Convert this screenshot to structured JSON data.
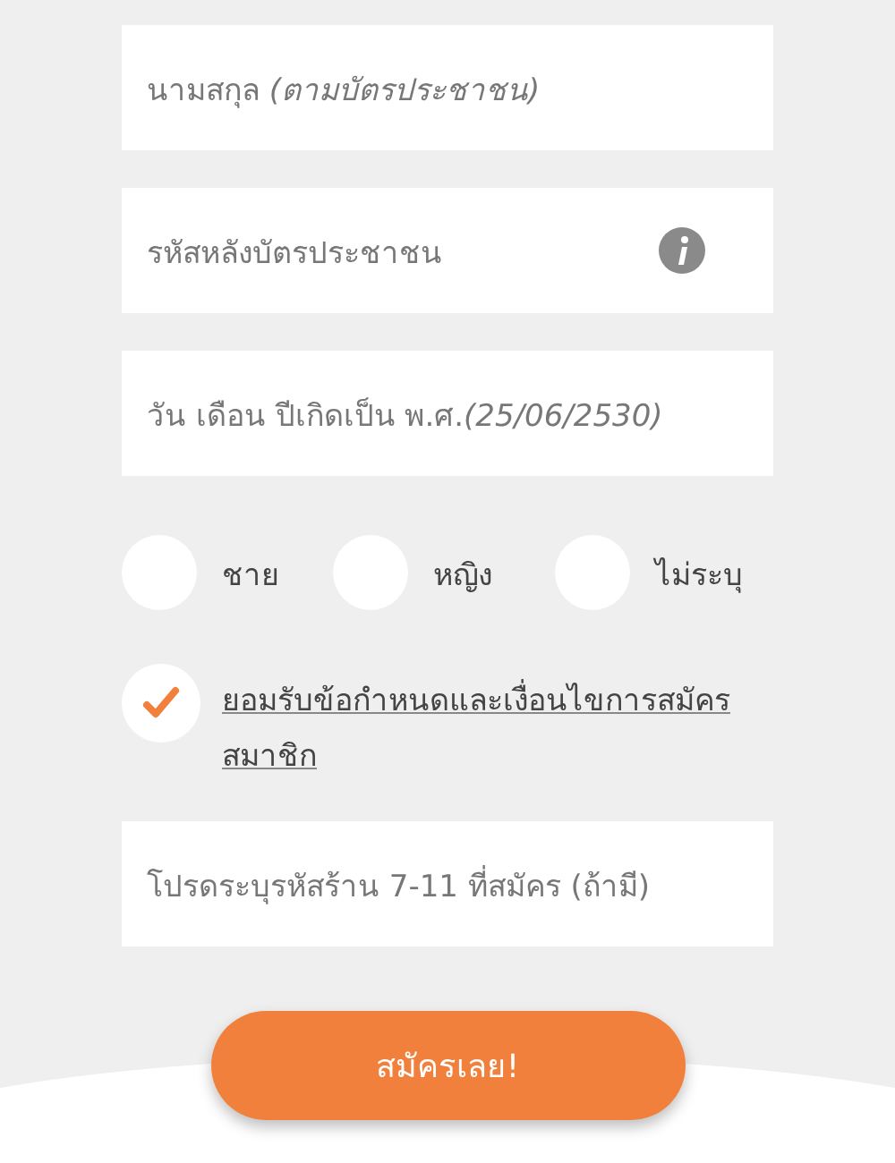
{
  "fields": [
    {
      "placeholder": "นามสกุล *(ตามบัตรประชาชน)*",
      "info": false
    },
    {
      "placeholder": "รหัสหลังบัตรประชาชน",
      "info": true
    },
    {
      "placeholder": "วัน เดือน ปีเกิดเป็น พ.ศ.*(25/06/2530)*",
      "info": false
    }
  ],
  "gender": [
    {
      "label": "ชาย",
      "selected": false
    },
    {
      "label": "หญิง",
      "selected": false
    },
    {
      "label": "ไม่ระบุ",
      "selected": false
    }
  ],
  "terms": {
    "label": "ยอมรับข้อกำหนดและเงื่อนไขการสมัครสมาชิก",
    "checked": true
  },
  "store_code": {
    "placeholder": "โปรดระบุรหัสร้าน 7-11 ที่สมัคร (ถ้ามี)"
  },
  "submit": "สมัครเลย!"
}
